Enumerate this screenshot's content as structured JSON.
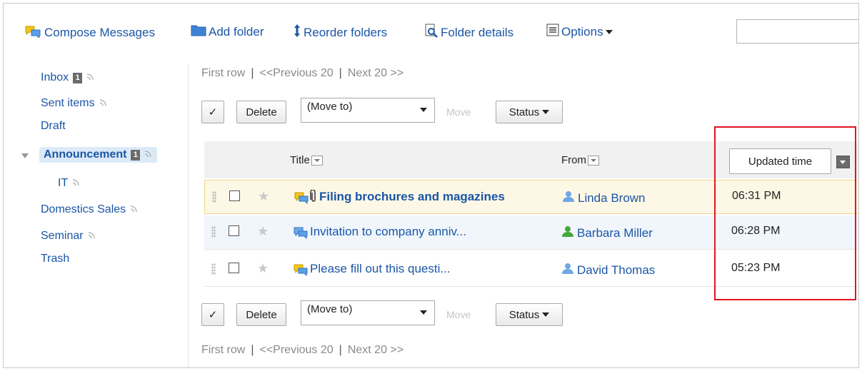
{
  "toolbar": {
    "compose": "Compose Messages",
    "add_folder": "Add folder",
    "reorder": "Reorder folders",
    "details": "Folder details",
    "options": "Options"
  },
  "search": {
    "value": ""
  },
  "sidebar": {
    "items": [
      {
        "label": "Inbox",
        "badge": "1"
      },
      {
        "label": "Sent items"
      },
      {
        "label": "Draft"
      },
      {
        "label": "Announcement",
        "badge": "1"
      },
      {
        "label": "IT"
      },
      {
        "label": "Domestics Sales"
      },
      {
        "label": "Seminar"
      },
      {
        "label": "Trash"
      }
    ]
  },
  "pager": {
    "first": "First row",
    "prev": "<<Previous 20",
    "next": "Next 20 >>"
  },
  "actions": {
    "check": "✓",
    "delete": "Delete",
    "move_to": "(Move to)",
    "move": "Move",
    "status": "Status"
  },
  "table": {
    "headers": {
      "title": "Title",
      "from": "From",
      "updated": "Updated time"
    },
    "rows": [
      {
        "title": "Filing brochures and magazines",
        "from": "Linda Brown",
        "time": "06:31 PM"
      },
      {
        "title": "Invitation to company anniv...",
        "from": "Barbara Miller",
        "time": "06:28 PM"
      },
      {
        "title": "Please fill out this questi...",
        "from": "David Thomas",
        "time": "05:23 PM"
      }
    ]
  },
  "colors": {
    "link": "#1a56a6",
    "highlight_border": "#e0161f",
    "unread_row": "#fdf7e6"
  }
}
